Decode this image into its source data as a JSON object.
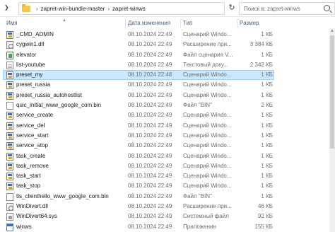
{
  "address": {
    "path": [
      "zapret-win-bundle-master",
      "zapret-winws"
    ]
  },
  "search": {
    "placeholder": "Поиск в: zapret-winws"
  },
  "columns": {
    "name": "Имя",
    "date": "Дата изменения",
    "type": "Тип",
    "size": "Размер"
  },
  "files": [
    {
      "name": "_CMD_ADMIN",
      "date": "08.10.2024 22:49",
      "type": "Сценарий Windo...",
      "size": "1 КБ",
      "icon": "batch-file-icon"
    },
    {
      "name": "cygwin1.dll",
      "date": "08.10.2024 22:49",
      "type": "Расширение при...",
      "size": "3 384 КБ",
      "icon": "dll-file-icon"
    },
    {
      "name": "elevator",
      "date": "08.10.2024 22:49",
      "type": "Файл сценария V...",
      "size": "1 КБ",
      "icon": "vbs-script-icon"
    },
    {
      "name": "list-youtube",
      "date": "08.10.2024 22:49",
      "type": "Текстовый доку...",
      "size": "2 342 КБ",
      "icon": "text-file-icon"
    },
    {
      "name": "preset_my",
      "date": "08.10.2024 22:48",
      "type": "Сценарий Windo...",
      "size": "1 КБ",
      "icon": "batch-file-icon"
    },
    {
      "name": "preset_russia",
      "date": "08.10.2024 22:49",
      "type": "Сценарий Windo...",
      "size": "1 КБ",
      "icon": "batch-file-icon"
    },
    {
      "name": "preset_russia_autohostlist",
      "date": "08.10.2024 22:49",
      "type": "Сценарий Windo...",
      "size": "1 КБ",
      "icon": "batch-file-icon"
    },
    {
      "name": "quic_initial_www_google_com.bin",
      "date": "08.10.2024 22:49",
      "type": "Файл \"BIN\"",
      "size": "2 КБ",
      "icon": "bin-file-icon"
    },
    {
      "name": "service_create",
      "date": "08.10.2024 22:49",
      "type": "Сценарий Windo...",
      "size": "1 КБ",
      "icon": "batch-file-icon"
    },
    {
      "name": "service_del",
      "date": "08.10.2024 22:49",
      "type": "Сценарий Windo...",
      "size": "1 КБ",
      "icon": "batch-file-icon"
    },
    {
      "name": "service_start",
      "date": "08.10.2024 22:49",
      "type": "Сценарий Windo...",
      "size": "1 КБ",
      "icon": "batch-file-icon"
    },
    {
      "name": "service_stop",
      "date": "08.10.2024 22:49",
      "type": "Сценарий Windo...",
      "size": "1 КБ",
      "icon": "batch-file-icon"
    },
    {
      "name": "task_create",
      "date": "08.10.2024 22:49",
      "type": "Сценарий Windo...",
      "size": "1 КБ",
      "icon": "batch-file-icon"
    },
    {
      "name": "task_remove",
      "date": "08.10.2024 22:49",
      "type": "Сценарий Windo...",
      "size": "1 КБ",
      "icon": "batch-file-icon"
    },
    {
      "name": "task_start",
      "date": "08.10.2024 22:49",
      "type": "Сценарий Windo...",
      "size": "1 КБ",
      "icon": "batch-file-icon"
    },
    {
      "name": "task_stop",
      "date": "08.10.2024 22:49",
      "type": "Сценарий Windo...",
      "size": "1 КБ",
      "icon": "batch-file-icon"
    },
    {
      "name": "tls_clienthello_www_google_com.bin",
      "date": "08.10.2024 22:49",
      "type": "Файл \"BIN\"",
      "size": "1 КБ",
      "icon": "bin-file-icon"
    },
    {
      "name": "WinDivert.dll",
      "date": "08.10.2024 22:49",
      "type": "Расширение при...",
      "size": "46 КБ",
      "icon": "dll-file-icon"
    },
    {
      "name": "WinDivert64.sys",
      "date": "08.10.2024 22:49",
      "type": "Системный файл",
      "size": "92 КБ",
      "icon": "sys-file-icon"
    },
    {
      "name": "winws",
      "date": "08.10.2024 22:49",
      "type": "Приложение",
      "size": "155 КБ",
      "icon": "application-icon"
    }
  ],
  "selected_row": "preset_my"
}
